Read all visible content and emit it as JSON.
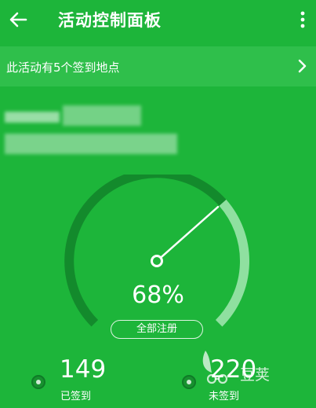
{
  "header": {
    "title": "活动控制面板"
  },
  "banner": {
    "text": "此活动有5个签到地点"
  },
  "gauge": {
    "percent_label": "68%",
    "fraction": 0.68
  },
  "all_register_button": "全部注册",
  "stats": {
    "signed": {
      "value": "149",
      "label": "已签到"
    },
    "unsigned": {
      "value": "220",
      "label": "未签到"
    }
  },
  "watermark": {
    "text": "豆荚"
  },
  "colors": {
    "background": "#1db53a",
    "gauge_track": "#138a2c",
    "gauge_remaining": "#8fe0a0"
  }
}
